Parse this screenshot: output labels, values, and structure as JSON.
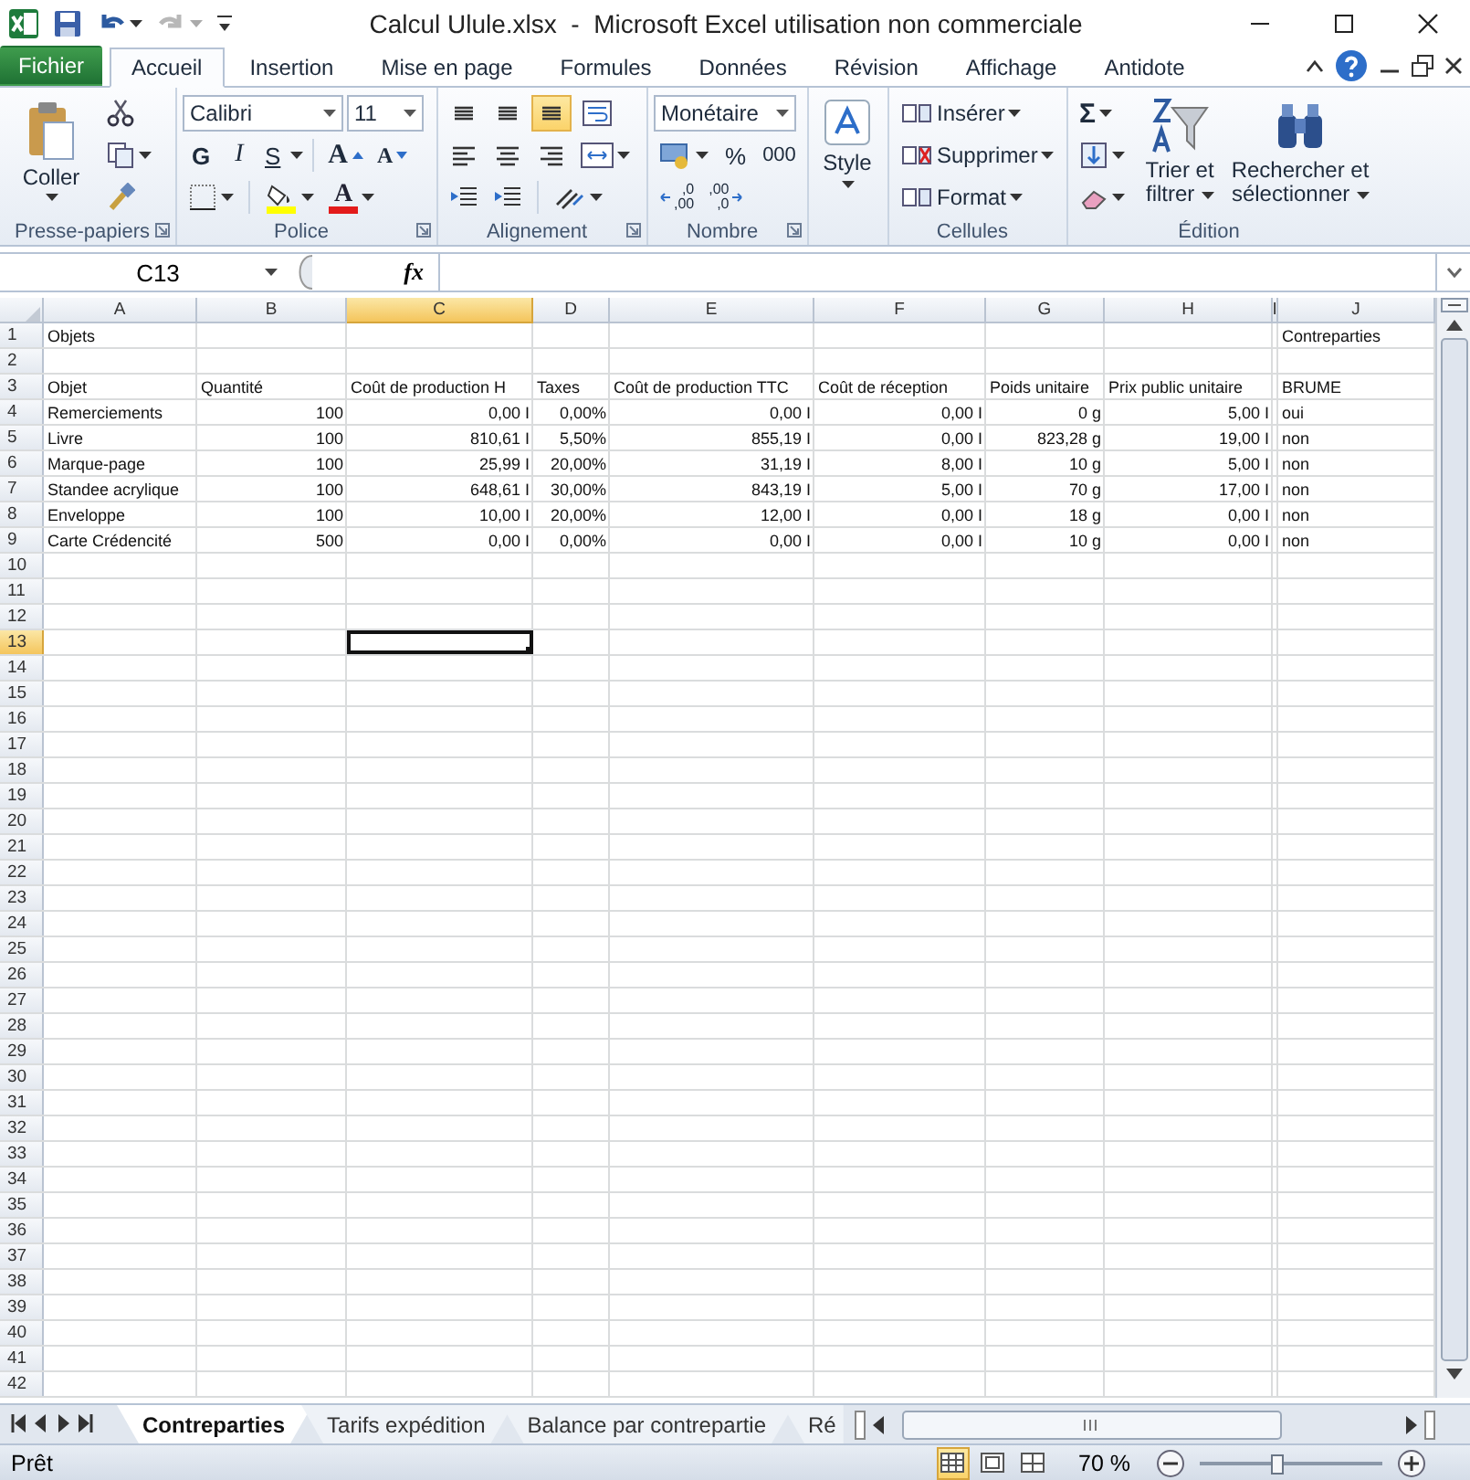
{
  "title_bar": {
    "title": "Calcul Ulule.xlsx  -  Microsoft Excel utilisation non commerciale"
  },
  "ribbon_tabs": {
    "file": "Fichier",
    "tabs": [
      {
        "label": "Accueil",
        "selected": true
      },
      {
        "label": "Insertion",
        "selected": false
      },
      {
        "label": "Mise en page",
        "selected": false
      },
      {
        "label": "Formules",
        "selected": false
      },
      {
        "label": "Données",
        "selected": false
      },
      {
        "label": "Révision",
        "selected": false
      },
      {
        "label": "Affichage",
        "selected": false
      },
      {
        "label": "Antidote",
        "selected": false
      }
    ]
  },
  "ribbon": {
    "clipboard": {
      "label": "Presse-papiers",
      "paste": "Coller"
    },
    "font": {
      "label": "Police",
      "font_name": "Calibri",
      "font_size": "11",
      "bold": "G",
      "italic": "I",
      "underline": "S",
      "grow": "A",
      "shrink": "A",
      "font_color": "A"
    },
    "alignment": {
      "label": "Alignement",
      "vertical": [
        {
          "selected": false
        },
        {
          "selected": false
        },
        {
          "selected": true
        }
      ]
    },
    "number": {
      "label": "Nombre",
      "format": "Monétaire",
      "percent": "%",
      "thousands": "000",
      "add_decimal": [
        ",0",
        ",00"
      ],
      "remove_decimal": [
        ",00",
        ",0"
      ]
    },
    "styles": {
      "button": "Style"
    },
    "cells": {
      "label": "Cellules",
      "buttons": [
        "Insérer",
        "Supprimer",
        "Format"
      ]
    },
    "editing": {
      "label": "Édition",
      "sum": "Σ",
      "sort": "Trier et filtrer",
      "find": "Rechercher et sélectionner"
    }
  },
  "formula_bar": {
    "name_box": "C13",
    "function_label": "fx"
  },
  "sheet": {
    "columns": [
      {
        "letter": "A",
        "selected": false
      },
      {
        "letter": "B",
        "selected": false
      },
      {
        "letter": "C",
        "selected": true
      },
      {
        "letter": "D",
        "selected": false
      },
      {
        "letter": "E",
        "selected": false
      },
      {
        "letter": "F",
        "selected": false
      },
      {
        "letter": "G",
        "selected": false
      },
      {
        "letter": "H",
        "selected": false
      },
      {
        "letter": "I",
        "selected": false
      },
      {
        "letter": "J",
        "selected": false
      }
    ],
    "rows": [
      {
        "number": "1",
        "selected": false,
        "cells": {
          "A": {
            "text": "Objets",
            "kind": "text"
          },
          "J": {
            "text": "Contreparties",
            "kind": "text"
          }
        }
      },
      {
        "number": "2",
        "selected": false
      },
      {
        "number": "3",
        "selected": false,
        "cells": {
          "A": {
            "text": "Objet",
            "kind": "text"
          },
          "B": {
            "text": "Quantité",
            "kind": "text"
          },
          "C": {
            "text": "Coût de production H",
            "kind": "text"
          },
          "D": {
            "text": "Taxes",
            "kind": "text"
          },
          "E": {
            "text": "Coût de production TTC",
            "kind": "text"
          },
          "F": {
            "text": "Coût de réception",
            "kind": "text"
          },
          "G": {
            "text": "Poids unitaire",
            "kind": "text"
          },
          "H": {
            "text": "Prix public unitaire",
            "kind": "text"
          },
          "J": {
            "text": "BRUME",
            "kind": "text"
          }
        }
      },
      {
        "number": "4",
        "selected": false,
        "cells": {
          "A": {
            "text": "Remerciements",
            "kind": "text"
          },
          "B": {
            "text": "100",
            "kind": "number"
          },
          "C": {
            "text": "0,00 I",
            "kind": "number"
          },
          "D": {
            "text": "0,00%",
            "kind": "number"
          },
          "E": {
            "text": "0,00 I",
            "kind": "number"
          },
          "F": {
            "text": "0,00 I",
            "kind": "number"
          },
          "G": {
            "text": "0 g",
            "kind": "number"
          },
          "H": {
            "text": "5,00 I",
            "kind": "number"
          },
          "J": {
            "text": "oui",
            "kind": "text"
          }
        }
      },
      {
        "number": "5",
        "selected": false,
        "cells": {
          "A": {
            "text": "Livre",
            "kind": "text"
          },
          "B": {
            "text": "100",
            "kind": "number"
          },
          "C": {
            "text": "810,61 I",
            "kind": "number"
          },
          "D": {
            "text": "5,50%",
            "kind": "number"
          },
          "E": {
            "text": "855,19 I",
            "kind": "number"
          },
          "F": {
            "text": "0,00 I",
            "kind": "number"
          },
          "G": {
            "text": "823,28 g",
            "kind": "number"
          },
          "H": {
            "text": "19,00 I",
            "kind": "number"
          },
          "J": {
            "text": "non",
            "kind": "text"
          }
        }
      },
      {
        "number": "6",
        "selected": false,
        "cells": {
          "A": {
            "text": "Marque-page",
            "kind": "text"
          },
          "B": {
            "text": "100",
            "kind": "number"
          },
          "C": {
            "text": "25,99 I",
            "kind": "number"
          },
          "D": {
            "text": "20,00%",
            "kind": "number"
          },
          "E": {
            "text": "31,19 I",
            "kind": "number"
          },
          "F": {
            "text": "8,00 I",
            "kind": "number"
          },
          "G": {
            "text": "10 g",
            "kind": "number"
          },
          "H": {
            "text": "5,00 I",
            "kind": "number"
          },
          "J": {
            "text": "non",
            "kind": "text"
          }
        }
      },
      {
        "number": "7",
        "selected": false,
        "cells": {
          "A": {
            "text": "Standee acrylique",
            "kind": "text"
          },
          "B": {
            "text": "100",
            "kind": "number"
          },
          "C": {
            "text": "648,61 I",
            "kind": "number"
          },
          "D": {
            "text": "30,00%",
            "kind": "number"
          },
          "E": {
            "text": "843,19 I",
            "kind": "number"
          },
          "F": {
            "text": "5,00 I",
            "kind": "number"
          },
          "G": {
            "text": "70 g",
            "kind": "number"
          },
          "H": {
            "text": "17,00 I",
            "kind": "number"
          },
          "J": {
            "text": "non",
            "kind": "text"
          }
        }
      },
      {
        "number": "8",
        "selected": false,
        "cells": {
          "A": {
            "text": "Enveloppe",
            "kind": "text"
          },
          "B": {
            "text": "100",
            "kind": "number"
          },
          "C": {
            "text": "10,00 I",
            "kind": "number"
          },
          "D": {
            "text": "20,00%",
            "kind": "number"
          },
          "E": {
            "text": "12,00 I",
            "kind": "number"
          },
          "F": {
            "text": "0,00 I",
            "kind": "number"
          },
          "G": {
            "text": "18 g",
            "kind": "number"
          },
          "H": {
            "text": "0,00 I",
            "kind": "number"
          },
          "J": {
            "text": "non",
            "kind": "text"
          }
        }
      },
      {
        "number": "9",
        "selected": false,
        "cells": {
          "A": {
            "text": "Carte Crédencité",
            "kind": "text"
          },
          "B": {
            "text": "500",
            "kind": "number"
          },
          "C": {
            "text": "0,00 I",
            "kind": "number"
          },
          "D": {
            "text": "0,00%",
            "kind": "number"
          },
          "E": {
            "text": "0,00 I",
            "kind": "number"
          },
          "F": {
            "text": "0,00 I",
            "kind": "number"
          },
          "G": {
            "text": "10 g",
            "kind": "number"
          },
          "H": {
            "text": "0,00 I",
            "kind": "number"
          },
          "J": {
            "text": "non",
            "kind": "text"
          }
        }
      },
      {
        "number": "10",
        "selected": false
      },
      {
        "number": "11",
        "selected": false
      },
      {
        "number": "12",
        "selected": false
      },
      {
        "number": "13",
        "selected": true
      },
      {
        "number": "14",
        "selected": false
      },
      {
        "number": "15",
        "selected": false
      },
      {
        "number": "16",
        "selected": false
      },
      {
        "number": "17",
        "selected": false
      },
      {
        "number": "18",
        "selected": false
      },
      {
        "number": "19",
        "selected": false
      },
      {
        "number": "20",
        "selected": false
      },
      {
        "number": "21",
        "selected": false
      },
      {
        "number": "22",
        "selected": false
      },
      {
        "number": "23",
        "selected": false
      },
      {
        "number": "24",
        "selected": false
      },
      {
        "number": "25",
        "selected": false
      },
      {
        "number": "26",
        "selected": false
      },
      {
        "number": "27",
        "selected": false
      },
      {
        "number": "28",
        "selected": false
      },
      {
        "number": "29",
        "selected": false
      },
      {
        "number": "30",
        "selected": false
      },
      {
        "number": "31",
        "selected": false
      },
      {
        "number": "32",
        "selected": false
      },
      {
        "number": "33",
        "selected": false
      },
      {
        "number": "34",
        "selected": false
      },
      {
        "number": "35",
        "selected": false
      },
      {
        "number": "36",
        "selected": false
      },
      {
        "number": "37",
        "selected": false
      },
      {
        "number": "38",
        "selected": false
      },
      {
        "number": "39",
        "selected": false
      },
      {
        "number": "40",
        "selected": false
      },
      {
        "number": "41",
        "selected": false
      },
      {
        "number": "42",
        "selected": false
      }
    ]
  },
  "sheet_tabs": [
    {
      "label": "Contreparties",
      "selected": true
    },
    {
      "label": "Tarifs expédition",
      "selected": false
    },
    {
      "label": "Balance par contrepartie",
      "selected": false
    },
    {
      "label": "Ré",
      "selected": false
    }
  ],
  "status_bar": {
    "status": "Prêt",
    "views": [
      {
        "selected": true
      },
      {
        "selected": false
      },
      {
        "selected": false
      }
    ],
    "zoom": "70 %",
    "zoom_slider": {
      "level": 0.42
    }
  }
}
